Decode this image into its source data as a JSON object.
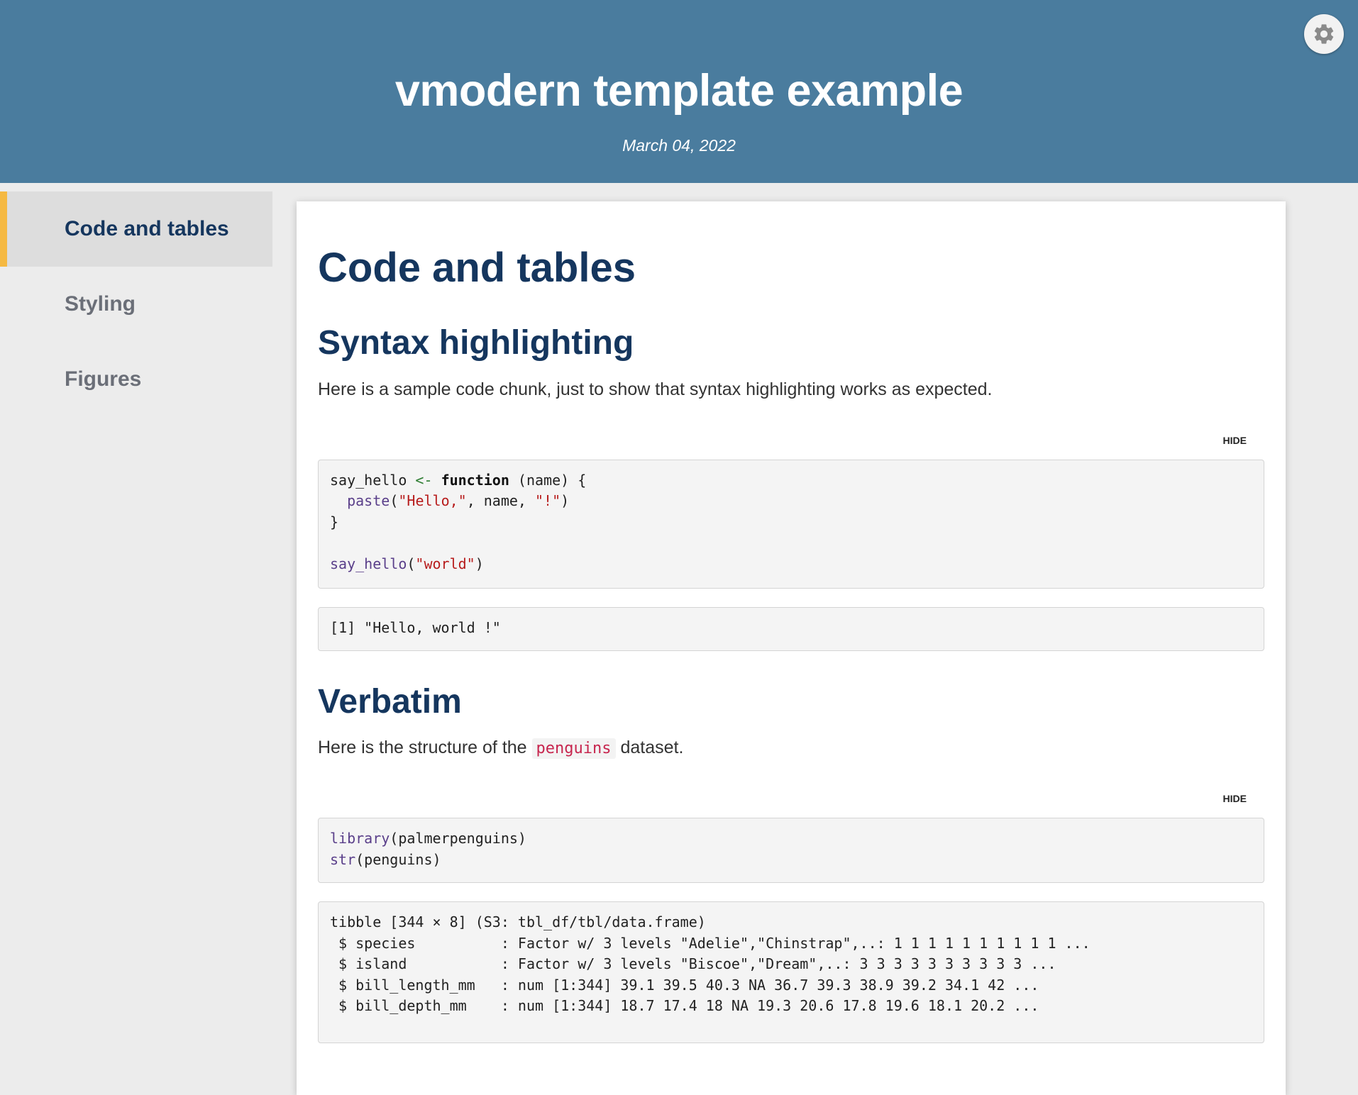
{
  "header": {
    "title": "vmodern template example",
    "date": "March 04, 2022",
    "settings_icon": "gear-icon"
  },
  "sidebar": {
    "items": [
      {
        "label": "Code and tables",
        "active": true
      },
      {
        "label": "Styling",
        "active": false
      },
      {
        "label": "Figures",
        "active": false
      }
    ]
  },
  "main": {
    "h1": "Code and tables",
    "section1": {
      "title": "Syntax highlighting",
      "text": "Here is a sample code chunk, just to show that syntax highlighting works as expected.",
      "hide_label": "HIDE",
      "code": {
        "l1_a": "say_hello ",
        "l1_op": "<-",
        "l1_b": " ",
        "l1_kw": "function",
        "l1_c": " (name) {",
        "l2_indent": "  ",
        "l2_fn": "paste",
        "l2_a": "(",
        "l2_str1": "\"Hello,\"",
        "l2_b": ", name, ",
        "l2_str2": "\"!\"",
        "l2_c": ")",
        "l3": "}",
        "l5_fn": "say_hello",
        "l5_a": "(",
        "l5_str": "\"world\"",
        "l5_b": ")"
      },
      "output": "[1] \"Hello, world !\""
    },
    "section2": {
      "title": "Verbatim",
      "text_before": "Here is the structure of the ",
      "inline_code": "penguins",
      "text_after": " dataset.",
      "hide_label": "HIDE",
      "code": {
        "l1_fn": "library",
        "l1_a": "(palmerpenguins)",
        "l2_fn": "str",
        "l2_a": "(penguins)"
      },
      "output_lines": [
        "tibble [344 × 8] (S3: tbl_df/tbl/data.frame)",
        " $ species          : Factor w/ 3 levels \"Adelie\",\"Chinstrap\",..: 1 1 1 1 1 1 1 1 1 1 ...",
        " $ island           : Factor w/ 3 levels \"Biscoe\",\"Dream\",..: 3 3 3 3 3 3 3 3 3 3 ...",
        " $ bill_length_mm   : num [1:344] 39.1 39.5 40.3 NA 36.7 39.3 38.9 39.2 34.1 42 ...",
        " $ bill_depth_mm    : num [1:344] 18.7 17.4 18 NA 19.3 20.6 17.8 19.6 18.1 20.2 ..."
      ]
    }
  },
  "colors": {
    "header_bg": "#4a7c9e",
    "heading": "#15365e",
    "active_marker": "#f5b942"
  }
}
